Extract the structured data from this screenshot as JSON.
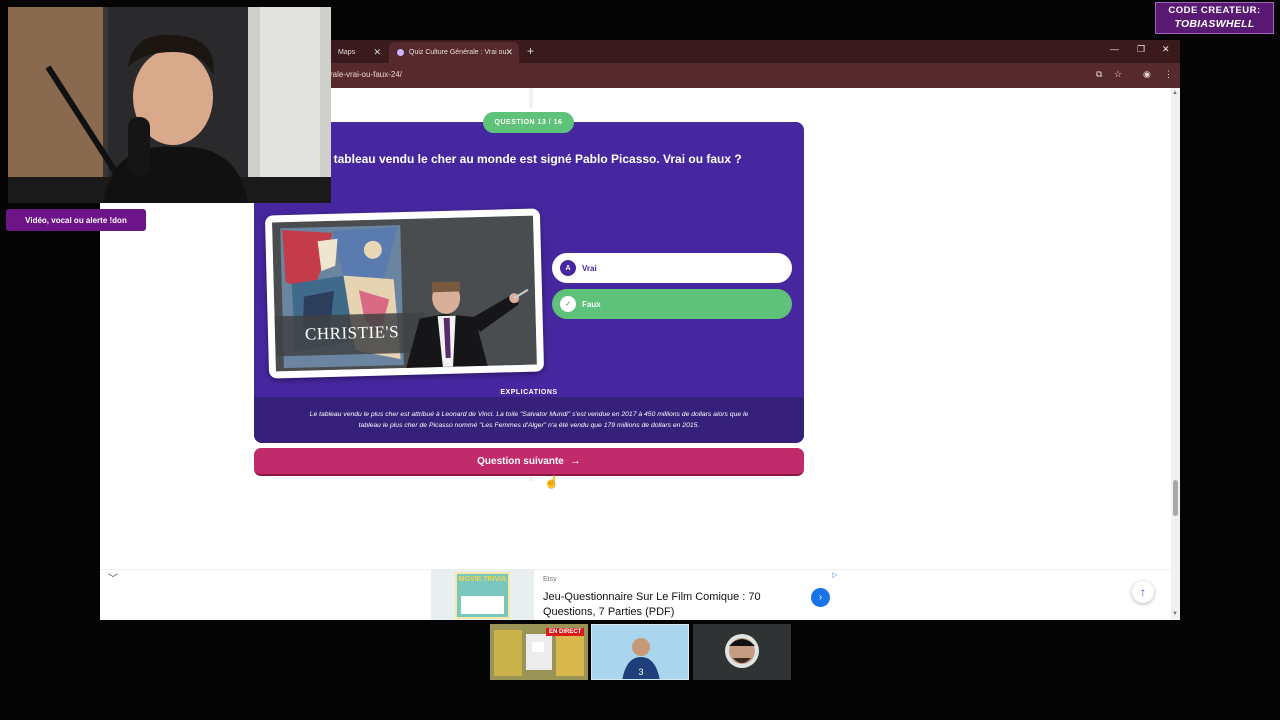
{
  "browser": {
    "tabs": [
      {
        "label": "Maps"
      },
      {
        "label": "Quiz Culture Générale : Vrai ou"
      }
    ],
    "url": "rale-vrai-ou-faux-24/"
  },
  "quiz": {
    "badge": "QUESTION 13 / 16",
    "question": "Le tableau vendu le cher au monde est signé Pablo Picasso. Vrai ou faux ?",
    "image_caption": "CHRISTIE'S",
    "answers": [
      {
        "letter": "A",
        "label": "Vrai",
        "state": "default"
      },
      {
        "letter": "✓",
        "label": "Faux",
        "state": "correct"
      }
    ],
    "explanation_title": "EXPLICATIONS",
    "explanation": "Le tableau vendu le plus cher est attribué à Leonard de Vinci. La toile \"Salvator Mundi\" s'est vendue en 2017 à 450 millions de dollars alors que le tableau le plus cher de Picasso nommé \"Les Femmes d'Alger\" n'a été vendu que 179 millions de dollars en 2015.",
    "next_button": "Question suivante"
  },
  "ad": {
    "brand": "Etsy",
    "title": "Jeu-Questionnaire Sur Le Film Comique : 70 Questions, 7 Parties (PDF)",
    "thumb_text": "MOVIE TRIVIA"
  },
  "overlay": {
    "alert": "Vidéo, vocal ou alerte !don",
    "creator_label": "CODE CREATEUR:",
    "creator_name": "TOBIASWHELL",
    "live_badge": "EN DIRECT"
  },
  "colors": {
    "card": "#4627a0",
    "correct": "#5ec27a",
    "next_button": "#c12a6b",
    "browser_frame": "#562a2d"
  },
  "icons": [
    "close-icon",
    "plus-icon",
    "minimize-icon",
    "restore-icon",
    "install-icon",
    "star-icon",
    "extension-icon",
    "menu-icon",
    "arrow-right-icon",
    "check-icon",
    "chevron-down-icon",
    "arrow-up-icon",
    "ad-choices-icon"
  ]
}
